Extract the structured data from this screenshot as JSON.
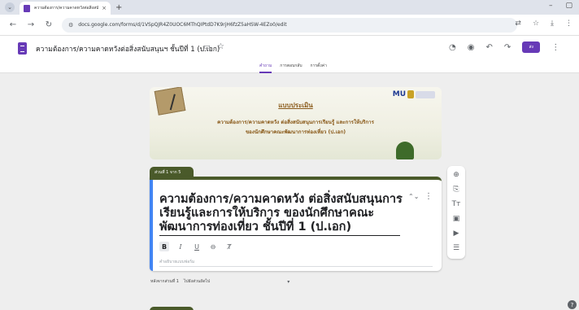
{
  "browser": {
    "tab_title": "ความต้องการ/ความคาดหวังต่อสิ่งสนับ...",
    "tab_close": "×",
    "new_tab": "+",
    "url": "docs.google.com/forms/d/1VSpQJR4Z0UOC6MThQIPtdD7K9rjH6fzZ5aHSW-4EZo0/edit"
  },
  "form": {
    "doc_title": "ความต้องการ/ความคาดหวังต่อสิ่งสนับสนุนฯ ชั้นปีที่ 1 (ป.เอก)",
    "send_label": "ส่ง",
    "tabs": [
      {
        "label": "คำถาม",
        "active": true
      },
      {
        "label": "การตอบกลับ",
        "active": false
      },
      {
        "label": "การตั้งค่า",
        "active": false
      }
    ],
    "accent_color": "#673ab7",
    "section_color": "#4a5a2a"
  },
  "banner": {
    "logo_text": "MU",
    "heading": "แบบประเมิน",
    "line1": "ความต้องการ/ความคาดหวัง ต่อสิ่งสนับสนุนการเรียนรู้ และการให้บริการ",
    "line2": "ของนักศึกษาคณะพัฒนาการท่องเที่ยว (ป.เอก)"
  },
  "section": {
    "label": "ส่วนที่ 1 จาก 5",
    "title": "ความต้องการ/ความคาดหวัง ต่อสิ่งสนับสนุนการเรียนรู้และการให้บริการ ของนักศึกษาคณะพัฒนาการท่องเที่ยว ชั้นปีที่ 1 (ป.เอก)",
    "description_placeholder": "คำอธิบายแบบฟอร์ม",
    "format_buttons": {
      "bold": "B",
      "italic": "I",
      "underline": "U",
      "link": "⊖",
      "clear": "Ⱦ"
    }
  },
  "after_section": {
    "label": "หลังจากส่วนที่ 1",
    "value": "ไปยังส่วนถัดไป"
  },
  "side_toolbar": [
    {
      "name": "add-question-icon",
      "glyph": "⊕"
    },
    {
      "name": "import-questions-icon",
      "glyph": "⎘"
    },
    {
      "name": "add-title-icon",
      "glyph": "Tт"
    },
    {
      "name": "add-image-icon",
      "glyph": "▣"
    },
    {
      "name": "add-video-icon",
      "glyph": "▶"
    },
    {
      "name": "add-section-icon",
      "glyph": "☰"
    }
  ]
}
